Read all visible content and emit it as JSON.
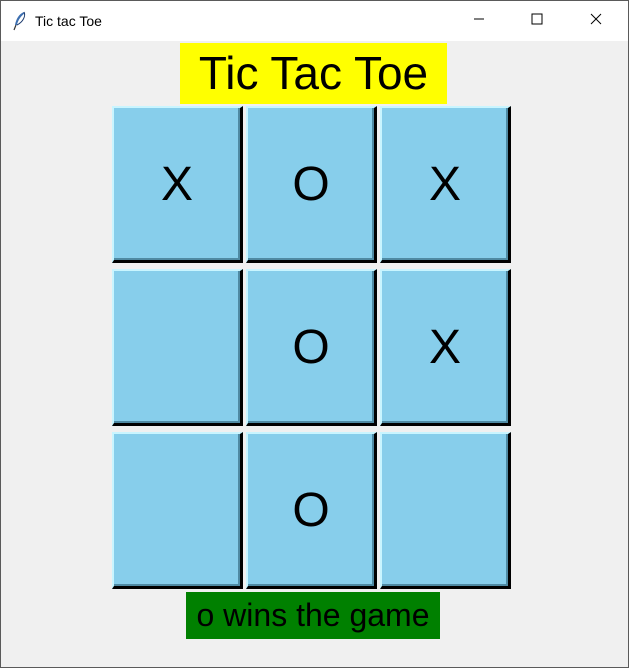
{
  "window": {
    "title": "Tic tac Toe",
    "icon": "feather-icon",
    "controls": {
      "minimize": "minimize-icon",
      "maximize": "maximize-icon",
      "close": "close-icon"
    }
  },
  "game": {
    "heading": "Tic Tac Toe",
    "board": [
      [
        "X",
        "O",
        "X"
      ],
      [
        "",
        "O",
        "X"
      ],
      [
        "",
        "O",
        ""
      ]
    ],
    "status": "o wins the game"
  },
  "colors": {
    "heading_bg": "#ffff00",
    "cell_bg": "#87ceeb",
    "status_bg": "#008000",
    "window_bg": "#f0f0f0"
  }
}
